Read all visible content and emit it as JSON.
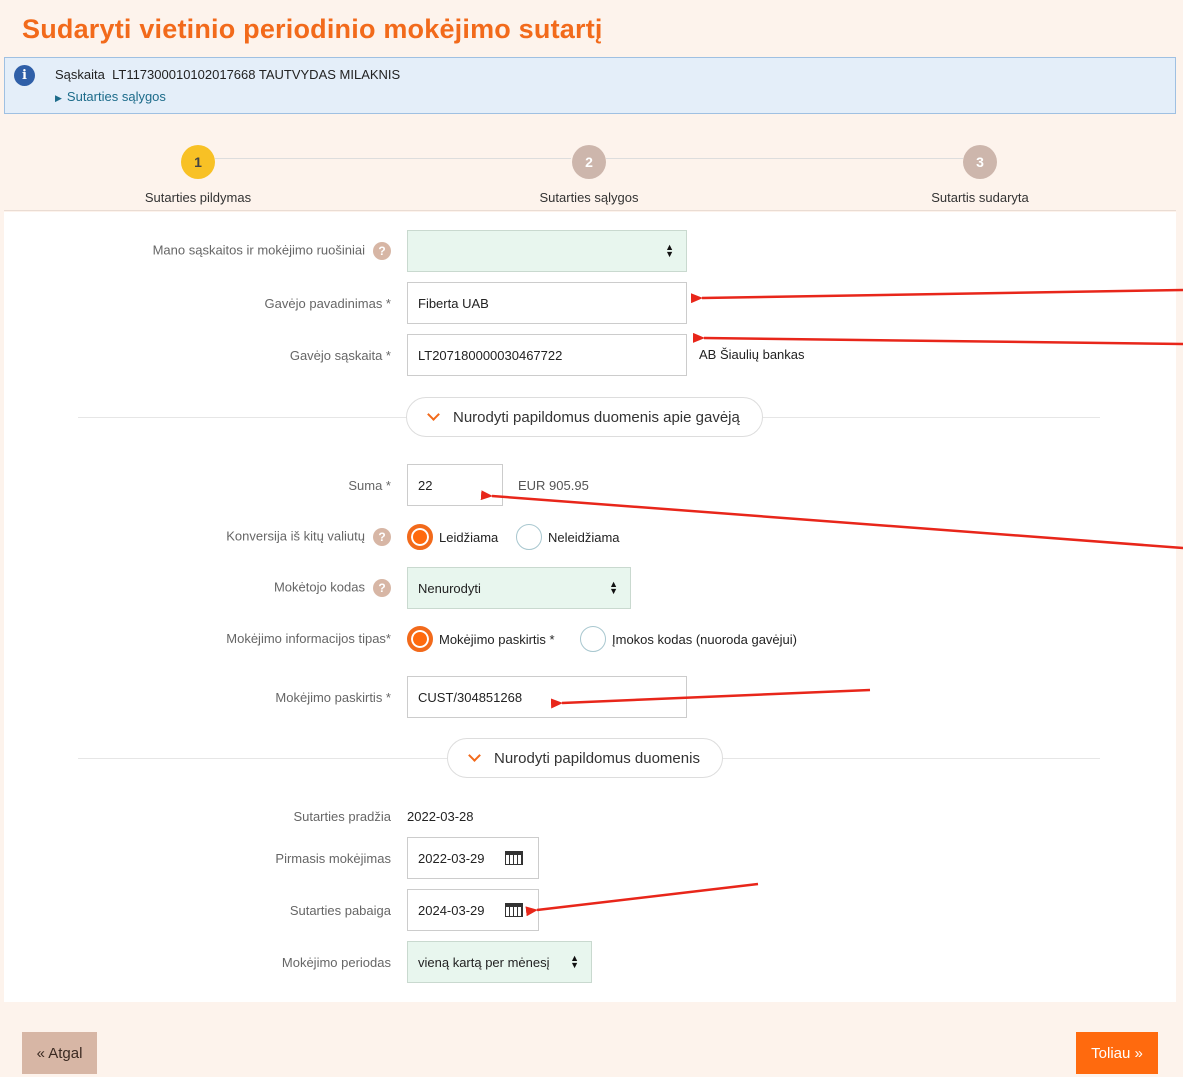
{
  "page": {
    "title": "Sudaryti vietinio periodinio mokėjimo sutartį"
  },
  "info": {
    "account_label": "Sąskaita",
    "account_value": "LT117300010102017668 TAUTVYDAS MILAKNIS",
    "terms_link": "Sutarties sąlygos"
  },
  "steps": [
    {
      "num": "1",
      "label": "Sutarties pildymas"
    },
    {
      "num": "2",
      "label": "Sutarties sąlygos"
    },
    {
      "num": "3",
      "label": "Sutartis sudaryta"
    }
  ],
  "form": {
    "templates_label": "Mano sąskaitos ir mokėjimo ruošiniai",
    "templates_value": "",
    "payee_name_label": "Gavėjo pavadinimas *",
    "payee_name_value": "Fiberta UAB",
    "payee_account_label": "Gavėjo sąskaita *",
    "payee_account_value": "LT207180000030467722",
    "payee_bank": "AB Šiaulių bankas",
    "payee_more_toggle": "Nurodyti papildomus duomenis apie gavėją",
    "amount_label": "Suma *",
    "amount_value": "22",
    "amount_balance": "EUR 905.95",
    "conversion_label": "Konversija iš kitų valiutų",
    "conversion_options": [
      "Leidžiama",
      "Neleidžiama"
    ],
    "payer_code_label": "Mokėtojo kodas",
    "payer_code_value": "Nenurodyti",
    "info_type_label": "Mokėjimo informacijos tipas*",
    "info_type_options": [
      "Mokėjimo paskirtis *",
      "Įmokos kodas (nuoroda gavėjui)"
    ],
    "purpose_label": "Mokėjimo paskirtis *",
    "purpose_value": "CUST/304851268",
    "more_toggle": "Nurodyti papildomus duomenis",
    "start_label": "Sutarties pradžia",
    "start_value": "2022-03-28",
    "first_payment_label": "Pirmasis mokėjimas",
    "first_payment_value": "2022-03-29",
    "end_label": "Sutarties pabaiga",
    "end_value": "2024-03-29",
    "period_label": "Mokėjimo periodas",
    "period_value": "vieną kartą per mėnesį"
  },
  "buttons": {
    "back": "« Atgal",
    "next": "Toliau »"
  },
  "colors": {
    "accent": "#f26a1b",
    "step_active": "#f8c125",
    "arrow": "#e8261a"
  }
}
